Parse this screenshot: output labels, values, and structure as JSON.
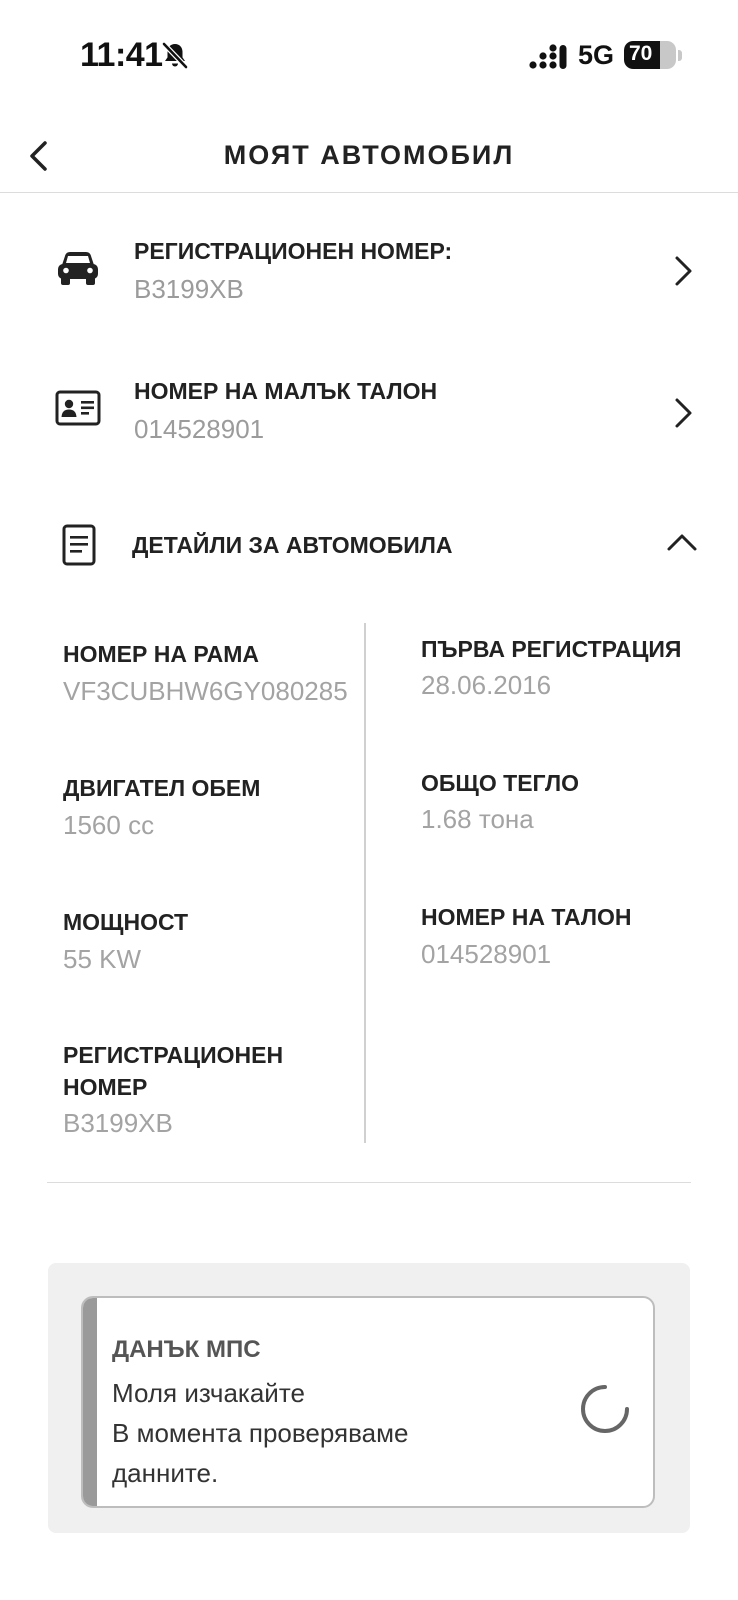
{
  "status_bar": {
    "time": "11:41",
    "network": "5G",
    "battery": "70",
    "battery_level": 0.7
  },
  "header": {
    "title": "МОЯТ АВТОМОБИЛ"
  },
  "rows": [
    {
      "label": "РЕГИСТРАЦИОНЕН НОМЕР:",
      "value": "B3199XB",
      "icon": "car-icon"
    },
    {
      "label": "НОМЕР НА МАЛЪК ТАЛОН",
      "value": "014528901",
      "icon": "id-card-icon"
    }
  ],
  "details": {
    "label": "ДЕТАЙЛИ ЗА АВТОМОБИЛА",
    "icon": "document-icon",
    "left": [
      {
        "label": "НОМЕР НА РАМА",
        "value": "VF3CUBHW6GY080285"
      },
      {
        "label": "ДВИГАТЕЛ ОБЕМ",
        "value": "1560 cc"
      },
      {
        "label": "МОЩНОСТ",
        "value": "55 KW"
      },
      {
        "label_line1": "РЕГИСТРАЦИОНЕН",
        "label_line2": "НОМЕР",
        "value": "B3199XB"
      }
    ],
    "right": [
      {
        "label": "ПЪРВА РЕГИСТРАЦИЯ",
        "value": "28.06.2016"
      },
      {
        "label": "ОБЩО ТЕГЛО",
        "value": "1.68 тона"
      },
      {
        "label": "НОМЕР НА ТАЛОН",
        "value": "014528901"
      }
    ]
  },
  "tax": {
    "title": "ДАНЪК МПС",
    "line1": "Моля изчакайте",
    "line2": "В момента проверяваме",
    "line3": "данните."
  },
  "colors": {
    "text": "#222222",
    "muted": "#9b9b9b",
    "accent_bar": "#9a9a9a",
    "panel": "#f0f0f0"
  }
}
